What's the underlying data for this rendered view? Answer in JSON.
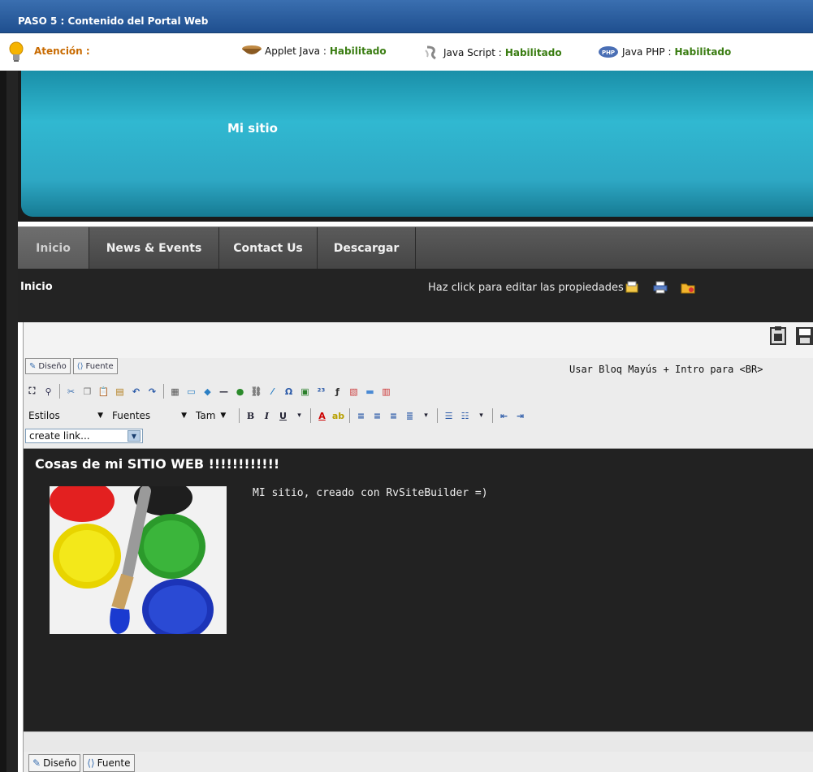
{
  "window": {
    "title": "PASO 5 : Contenido del Portal Web"
  },
  "attention": {
    "label": "Atención :",
    "items": [
      {
        "name": "Applet Java :",
        "status": "Habilitado",
        "icon": "coffee-cup-icon"
      },
      {
        "name": "Java Script :",
        "status": "Habilitado",
        "icon": "javascript-icon"
      },
      {
        "name": "Java PHP :",
        "status": "Habilitado",
        "icon": "php-icon"
      }
    ]
  },
  "site": {
    "title": "Mi sitio"
  },
  "nav": {
    "tabs": [
      "Inicio",
      "News & Events",
      "Contact Us",
      "Descargar"
    ]
  },
  "page": {
    "heading": "Inicio",
    "edit_hint": "Haz click para editar las propiedades"
  },
  "editor": {
    "tab_design": "Diseño",
    "tab_source": "Fuente",
    "shortcut_hint": "Usar Bloq Mayús + Intro para <BR>",
    "styles_select": "Estilos",
    "fonts_select": "Fuentes",
    "size_select": "Tam",
    "link_select": "create link...",
    "content_title": "Cosas de mi SITIO WEB !!!!!!!!!!!!",
    "content_text": "MI sitio, creado con RvSiteBuilder =)",
    "bottom_tab_design": "Diseño",
    "bottom_tab_source": "Fuente"
  },
  "colors": {
    "title_bar": "#2a5d9e",
    "banner": "#2aa7c2",
    "ok_status": "#3a7d12",
    "attention": "#c86a00"
  }
}
